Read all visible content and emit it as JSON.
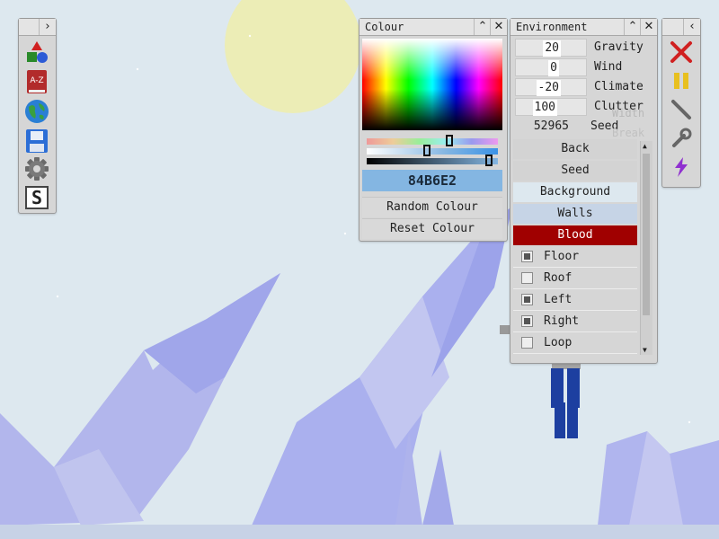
{
  "toolbar": {
    "items": [
      {
        "icon": "shapes-icon"
      },
      {
        "icon": "a-z-book-icon",
        "text": "A-Z"
      },
      {
        "icon": "globe-icon"
      },
      {
        "icon": "save-disk-icon"
      },
      {
        "icon": "gear-icon"
      },
      {
        "icon": "s-icon",
        "text": "S"
      }
    ]
  },
  "colour_panel": {
    "title": "Colour",
    "hex": "84B6E2",
    "random_label": "Random Colour",
    "reset_label": "Reset Colour",
    "colors": {
      "current": "#84b6e2"
    }
  },
  "environment": {
    "title": "Environment",
    "rows": [
      {
        "value": "20",
        "label": "Gravity"
      },
      {
        "value": "0",
        "label": "Wind"
      },
      {
        "value": "-20",
        "label": "Climate"
      },
      {
        "value": "100",
        "label": "Clutter"
      },
      {
        "value": "52965",
        "label": "Seed"
      }
    ],
    "ghost_labels": [
      "Width",
      "Break"
    ],
    "list": [
      {
        "label": "Back"
      },
      {
        "label": "Seed"
      },
      {
        "label": "Background"
      },
      {
        "label": "Walls"
      },
      {
        "label": "Blood"
      }
    ],
    "checks": [
      {
        "label": "Floor",
        "checked": true
      },
      {
        "label": "Roof",
        "checked": false
      },
      {
        "label": "Left",
        "checked": true
      },
      {
        "label": "Right",
        "checked": true
      },
      {
        "label": "Loop",
        "checked": false
      }
    ],
    "colors": {
      "background": "#dde8ef",
      "walls": "#c6d4e6",
      "blood": "#a00000"
    }
  },
  "right_tools": {
    "items": [
      {
        "icon": "close-x-icon"
      },
      {
        "icon": "pause-icon"
      },
      {
        "icon": "line-tool-icon"
      },
      {
        "icon": "wrench-icon"
      },
      {
        "icon": "lightning-icon"
      }
    ]
  }
}
